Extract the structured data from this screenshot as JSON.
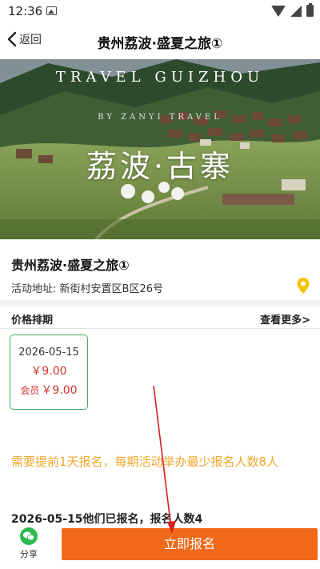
{
  "status_bar": {
    "time": "12:36"
  },
  "nav": {
    "back_label": "返回",
    "title": "贵州荔波·盛夏之旅①"
  },
  "hero": {
    "title_en": "TRAVEL GUIZHOU",
    "subtitle_en": "BY ZANYI TRAVEL",
    "title_cn": "荔波·古寨"
  },
  "info": {
    "title": "贵州荔波·盛夏之旅①",
    "address_label": "活动地址:",
    "address": "新街村安置区B区26号"
  },
  "schedule": {
    "section_title": "价格排期",
    "see_more": "查看更多>",
    "cards": [
      {
        "date": "2026-05-15",
        "price": "￥9.00",
        "member_label": "会员",
        "member_price": "￥9.00"
      }
    ]
  },
  "notice": "需要提前1天报名，每期活动举办最少报名人数8人",
  "signup_count_text": "2026-05-15他们已报名，报名人数4",
  "bottom": {
    "share_label": "分享",
    "signup_label": "立即报名"
  },
  "colors": {
    "accent_orange": "#f06a1a",
    "price_red": "#d0322b",
    "notice_orange": "#f0a82b",
    "card_border_green": "#3fae5b",
    "pin_yellow": "#f5c400",
    "wechat_green": "#2dba4e",
    "annotation_red": "#d81e1e"
  }
}
